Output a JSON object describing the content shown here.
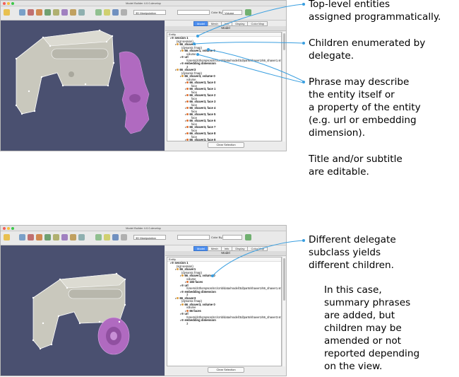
{
  "callouts": {
    "top_level": "Top-level entities\nassigned programmatically.",
    "children": "Children enumerated by\ndelegate.",
    "phrase": "Phrase may describe\nthe entity itself or\na property of the entity\n(e.g. url or embedding\ndimension).",
    "title_note": "Title and/or subtitle\nare editable.",
    "delegate": "Different delegate\nsubclass yields\ndifferent children.",
    "summary": "In this case,\nsummary phrases\nare added, but\nchildren may be\namended or not\nreported depending\non the view."
  },
  "app": {
    "window_title": "Model Builder 4.0.0-develop",
    "manipulation_mode": "3D Manipulation",
    "color_by_label": "Color By",
    "color_by_value": "Volume",
    "tabs": [
      "Model",
      "Mesh",
      "Info",
      "Display",
      "Color Map"
    ],
    "panel_title": "Model",
    "column_header": "Entity",
    "clear_button": "Clear Selection"
  },
  "tree1": [
    {
      "text": "session 1",
      "sub": "(sgt session)",
      "indent": 0,
      "bold": true,
      "dot": "#888"
    },
    {
      "text": "66_shaver1",
      "sub": "(dynamic fmap)",
      "indent": 1,
      "bold": true,
      "dot": "#e0a040"
    },
    {
      "text": "66_shaver1, volume 0",
      "sub": "volume",
      "indent": 2,
      "bold": true,
      "dot": "#e0a040"
    },
    {
      "text": "url",
      "sub": "/Users/dcthompson/src/cmb/data/model/3d/parts/shaver1/66_shaver1.smp",
      "indent": 2,
      "bold": true,
      "dot": "#888"
    },
    {
      "text": "embedding dimension",
      "sub": "3",
      "indent": 2,
      "bold": true,
      "dot": "#888"
    },
    {
      "text": "66_shaver3",
      "sub": "(dynamic fmap)",
      "indent": 1,
      "bold": true,
      "dot": "#e0a040"
    },
    {
      "text": "66_shaver3, volume 0",
      "sub": "volume",
      "indent": 2,
      "bold": true,
      "dot": "#e0a040"
    },
    {
      "text": "66_shaver3, face 0",
      "sub": "face",
      "indent": 3,
      "bold": true,
      "dot": "#e07030"
    },
    {
      "text": "66_shaver3, face 1",
      "sub": "face",
      "indent": 3,
      "bold": true,
      "dot": "#e07030"
    },
    {
      "text": "66_shaver3, face 2",
      "sub": "face",
      "indent": 3,
      "bold": true,
      "dot": "#e07030"
    },
    {
      "text": "66_shaver3, face 3",
      "sub": "face",
      "indent": 3,
      "bold": true,
      "dot": "#e07030"
    },
    {
      "text": "66_shaver3, face 4",
      "sub": "face",
      "indent": 3,
      "bold": true,
      "dot": "#e07030"
    },
    {
      "text": "66_shaver3, face 5",
      "sub": "face",
      "indent": 3,
      "bold": true,
      "dot": "#e07030"
    },
    {
      "text": "66_shaver3, face 6",
      "sub": "face",
      "indent": 3,
      "bold": true,
      "dot": "#e07030"
    },
    {
      "text": "66_shaver3, face 7",
      "sub": "face",
      "indent": 3,
      "bold": true,
      "dot": "#e07030"
    },
    {
      "text": "66_shaver3, face 8",
      "sub": "face",
      "indent": 3,
      "bold": true,
      "dot": "#e07030"
    },
    {
      "text": "66_shaver3, face 9",
      "sub": "face",
      "indent": 3,
      "bold": true,
      "dot": "#e07030"
    }
  ],
  "tree2": [
    {
      "text": "session 1",
      "sub": "(sgt session)",
      "indent": 0,
      "bold": true,
      "dot": "#888"
    },
    {
      "text": "66_shaver1",
      "sub": "(dynamic fmap)",
      "indent": 1,
      "bold": true,
      "dot": "#e0a040"
    },
    {
      "text": "66_shaver1, volume 0",
      "sub": "volume",
      "indent": 2,
      "bold": true,
      "dot": "#e0a040"
    },
    {
      "text": "183 faces",
      "sub": "",
      "indent": 3,
      "bold": true,
      "dot": "#e07030"
    },
    {
      "text": "url",
      "sub": "/Users/dcthompson/src/cmb/data/model/3d/parts/shaver1/66_shaver1.smp",
      "indent": 2,
      "bold": true,
      "dot": "#888"
    },
    {
      "text": "embedding dimension",
      "sub": "3",
      "indent": 2,
      "bold": true,
      "dot": "#888"
    },
    {
      "text": "66_shaver3",
      "sub": "(dynamic fmap)",
      "indent": 1,
      "bold": true,
      "dot": "#e0a040"
    },
    {
      "text": "66_shaver3, volume 0",
      "sub": "volume",
      "indent": 2,
      "bold": true,
      "dot": "#e0a040"
    },
    {
      "text": "66 faces",
      "sub": "",
      "indent": 3,
      "bold": true,
      "dot": "#e07030"
    },
    {
      "text": "url",
      "sub": "/Users/dcthompson/src/cmb/data/model/3d/parts/shaver1/66_shaver3.smp",
      "indent": 2,
      "bold": true,
      "dot": "#888"
    },
    {
      "text": "embedding dimension",
      "sub": "3",
      "indent": 2,
      "bold": true,
      "dot": "#888"
    }
  ],
  "colors": {
    "viewport_bg": "#4a5070",
    "model_gray": "#c9c8bd",
    "model_purple": "#b06ac0",
    "callout_line": "#3a9fe0",
    "tab_active": "#4b8ef0"
  }
}
